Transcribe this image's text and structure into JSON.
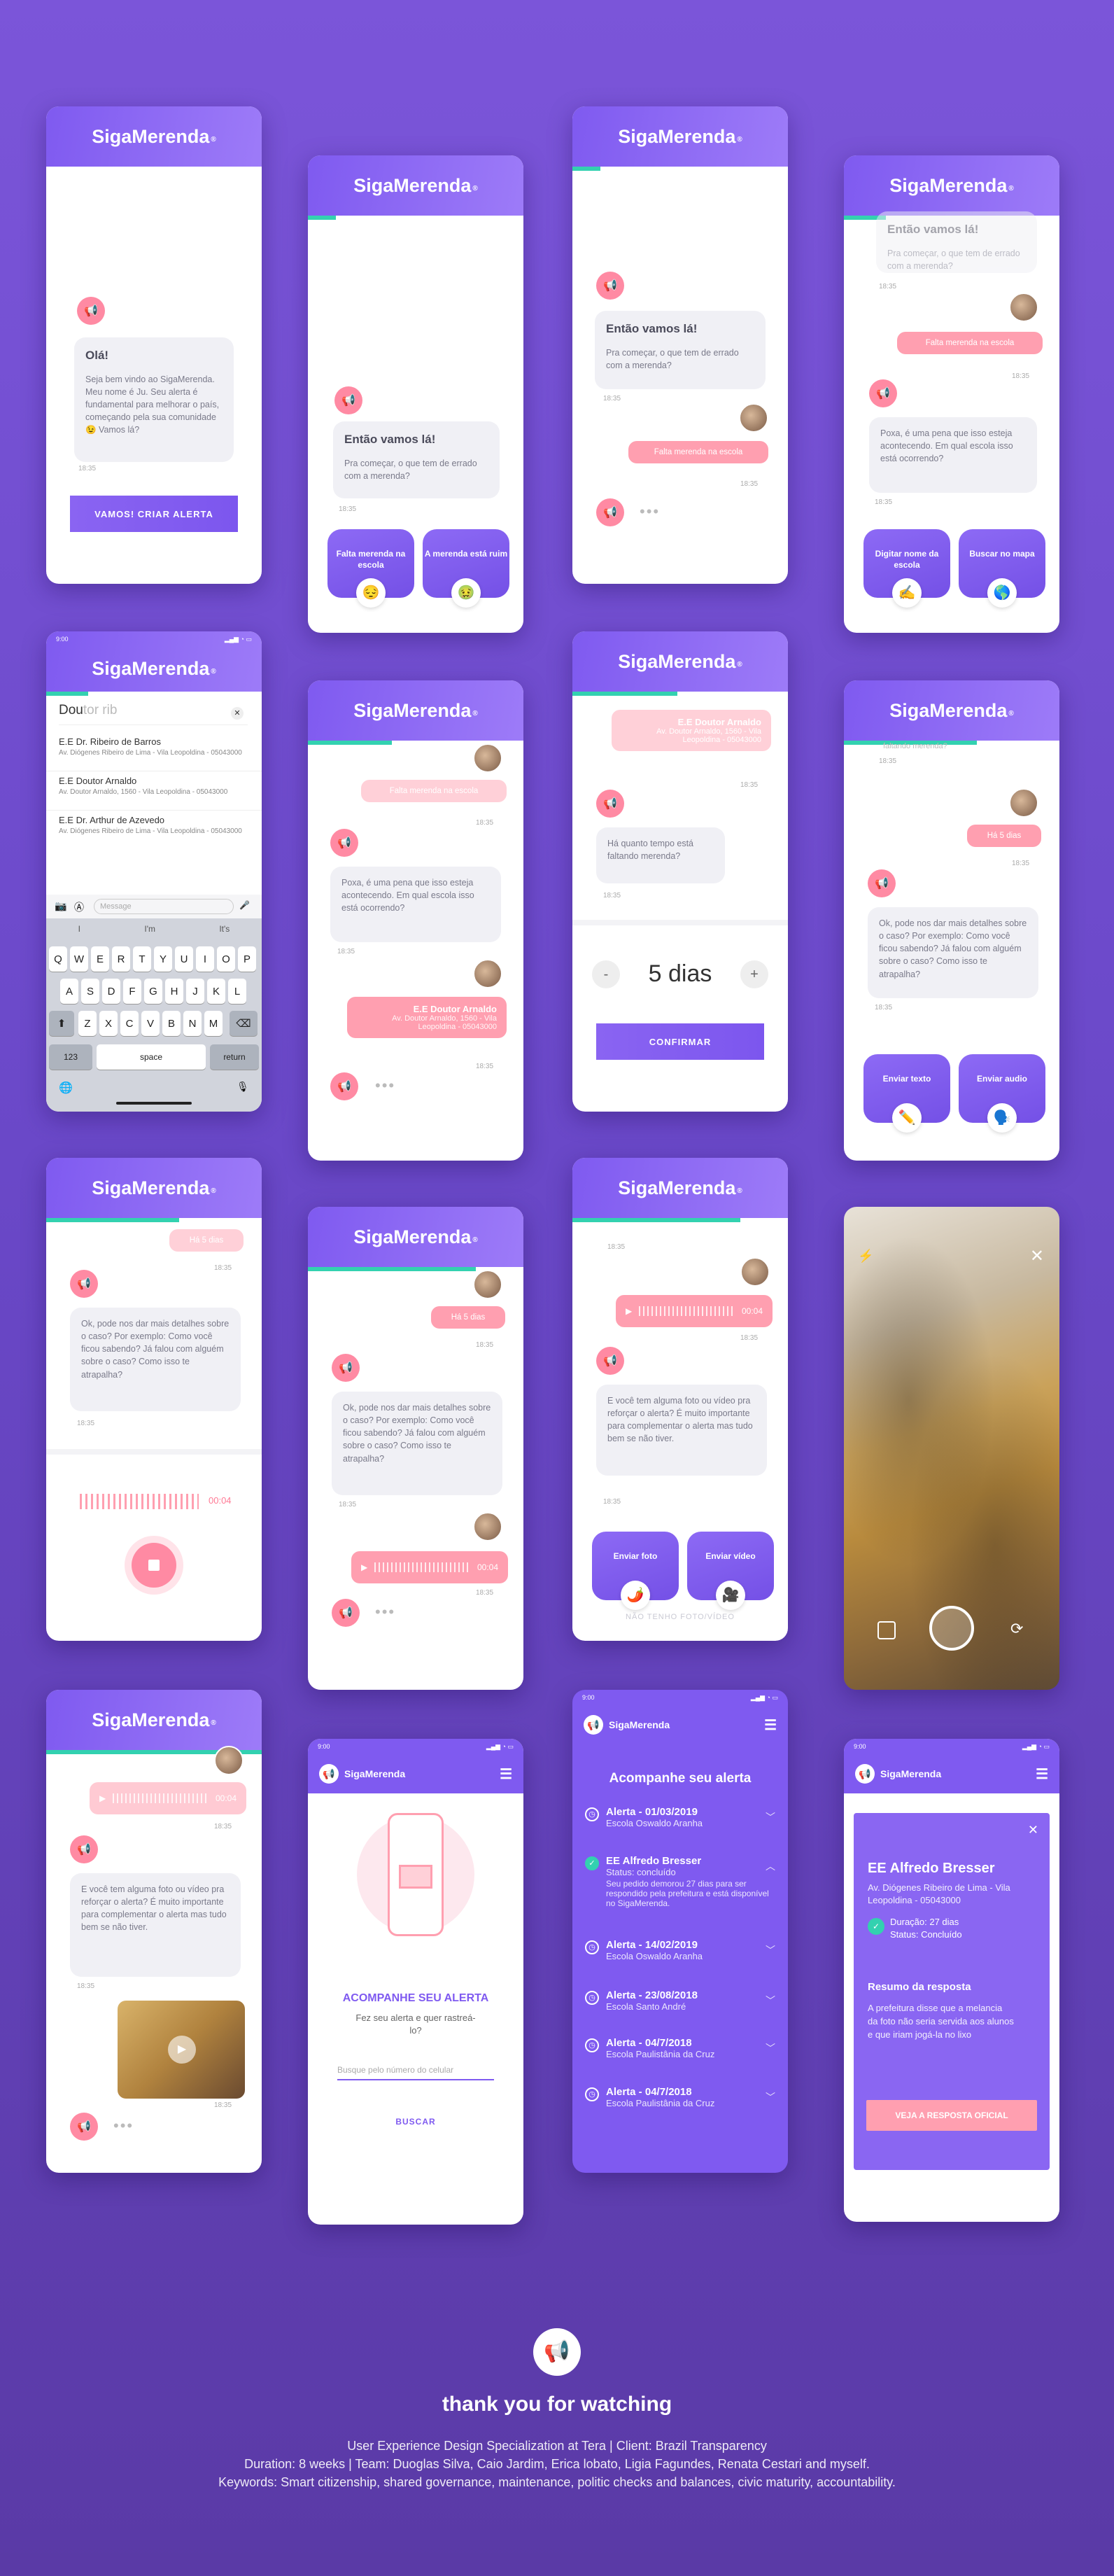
{
  "brand": {
    "name": "SigaMerenda",
    "reg": "®"
  },
  "status": {
    "time": "9:00"
  },
  "s1": {
    "title": "Olá!",
    "text": "Seja bem vindo ao SigaMerenda. Meu nome é Ju. Seu alerta é fundamental para melhorar o país, começando pela sua comunidade 😉 Vamos lá?",
    "time": "18:35",
    "cta": "VAMOS! CRIAR ALERTA"
  },
  "s2": {
    "title": "Então vamos lá!",
    "text": "Pra começar, o que tem de errado com a merenda?",
    "time": "18:35",
    "opt1": "Falta merenda na escola",
    "opt2": "A merenda está ruim",
    "icon1": "😔",
    "icon2": "🤢"
  },
  "s3": {
    "title": "Então vamos lá!",
    "text": "Pra começar, o que tem de errado com a merenda?",
    "time": "18:35",
    "reply": "Falta merenda na escola",
    "time2": "18:35"
  },
  "s4": {
    "title": "Então vamos lá!",
    "text": "Pra começar, o que tem de errado com a merenda?",
    "time": "18:35",
    "reply": "Falta merenda na escola",
    "time2": "18:35",
    "q": "Poxa, é uma pena que isso esteja acontecendo. Em qual escola isso está ocorrendo?",
    "time3": "18:35",
    "opt1": "Digitar nome da escola",
    "opt2": "Buscar no mapa",
    "icon1": "✍️",
    "icon2": "🌎"
  },
  "s5": {
    "search": "Dou",
    "search_rest": "tor rib",
    "results": [
      {
        "name": "E.E Dr. Ribeiro de Barros",
        "addr": "Av. Diógenes Ribeiro de Lima - Vila Leopoldina - 05043000"
      },
      {
        "name": "E.E Doutor Arnaldo",
        "addr": "Av. Doutor Arnaldo, 1560 - Vila Leopoldina - 05043000"
      },
      {
        "name": "E.E Dr. Arthur de Azevedo",
        "addr": "Av. Diógenes Ribeiro de Lima - Vila Leopoldina - 05043000"
      }
    ],
    "placeholder": "Message",
    "sugg": [
      "I",
      "I'm",
      "It's"
    ],
    "row1": [
      "Q",
      "W",
      "E",
      "R",
      "T",
      "Y",
      "U",
      "I",
      "O",
      "P"
    ],
    "row2": [
      "A",
      "S",
      "D",
      "F",
      "G",
      "H",
      "J",
      "K",
      "L"
    ],
    "row3": [
      "Z",
      "X",
      "C",
      "V",
      "B",
      "N",
      "M"
    ],
    "k123": "123",
    "space": "space",
    "ret": "return"
  },
  "s6": {
    "reply": "Falta merenda na escola",
    "time": "18:35",
    "q": "Poxa, é uma pena que isso esteja acontecendo. Em qual escola isso está ocorrendo?",
    "time2": "18:35",
    "school": "E.E Doutor Arnaldo",
    "addr": "Av. Doutor Arnaldo, 1560 - Vila Leopoldina - 05043000",
    "time3": "18:35"
  },
  "s7": {
    "school": "E.E Doutor Arnaldo",
    "addr": "Av. Doutor Arnaldo, 1560 - Vila Leopoldina - 05043000",
    "time": "18:35",
    "q": "Há quanto tempo está faltando merenda?",
    "time2": "18:35",
    "value": "5 dias",
    "minus": "-",
    "plus": "+",
    "cta": "CONFIRMAR"
  },
  "s8": {
    "top": "faltando merenda?",
    "time": "18:35",
    "reply": "Há 5 dias",
    "time2": "18:35",
    "q": "Ok, pode nos dar mais detalhes sobre o caso? Por exemplo: Como você ficou sabendo? Já falou com alguém sobre o caso? Como isso te atrapalha?",
    "time3": "18:35",
    "opt1": "Enviar texto",
    "opt2": "Enviar audio",
    "icon1": "✏️",
    "icon2": "🗣️"
  },
  "s9": {
    "reply": "Há 5 dias",
    "time": "18:35",
    "q": "Ok, pode nos dar mais detalhes sobre o caso? Por exemplo: Como você ficou sabendo? Já falou com alguém sobre o caso? Como isso te atrapalha?",
    "time2": "18:35",
    "rec": "00:04"
  },
  "s10": {
    "reply": "Há 5 dias",
    "time": "18:35",
    "q": "Ok, pode nos dar mais detalhes sobre o caso? Por exemplo: Como você ficou sabendo? Já falou com alguém sobre o caso? Como isso te atrapalha?",
    "time2": "18:35",
    "audio": "00:04",
    "time3": "18:35"
  },
  "s11": {
    "time": "18:35",
    "audio": "00:04",
    "time2": "18:35",
    "q": "E você tem alguma foto ou vídeo pra reforçar o alerta? É muito importante para complementar o alerta mas tudo bem se não tiver.",
    "time3": "18:35",
    "opt1": "Enviar foto",
    "opt2": "Enviar vídeo",
    "icon1": "🌶️",
    "icon2": "🎥",
    "skip": "NÃO TENHO FOTO/VÍDEO"
  },
  "s13": {
    "audio": "00:04",
    "time": "18:35",
    "q": "E você tem alguma foto ou vídeo pra reforçar o alerta? É muito importante para complementar o alerta mas tudo bem se não tiver.",
    "time2": "18:35",
    "time3": "18:35"
  },
  "s14": {
    "title": "ACOMPANHE SEU ALERTA",
    "sub": "Fez seu alerta e quer rastreá-lo?",
    "placeholder": "Busque pelo número do celular",
    "cta": "BUSCAR"
  },
  "s15": {
    "title": "Acompanhe seu alerta",
    "items": [
      {
        "t": "Alerta - 01/03/2019",
        "s": "Escola Oswaldo Aranha"
      },
      {
        "t": "EE Alfredo Bresser",
        "s": "Status: concluído",
        "d": "Seu pedido demorou 27 dias para ser respondido pela prefeitura e está disponível no SigaMerenda."
      },
      {
        "t": "Alerta - 14/02/2019",
        "s": "Escola Oswaldo Aranha"
      },
      {
        "t": "Alerta - 23/08/2018",
        "s": "Escola Santo André"
      },
      {
        "t": "Alerta - 04/7/2018",
        "s": "Escola Paulistânia da Cruz"
      },
      {
        "t": "Alerta - 04/7/2018",
        "s": "Escola Paulistânia da Cruz"
      }
    ]
  },
  "s16": {
    "title": "EE Alfredo Bresser",
    "addr": "Av. Diógenes Ribeiro de Lima - Vila Leopoldina - 05043000",
    "dur": "Duração: 27 dias",
    "status": "Status: Concluído",
    "sum": "Resumo da resposta",
    "sumtext": "A prefeitura disse que a melancia da foto não seria servida aos alunos e que iriam jogá-la no lixo",
    "cta": "VEJA A RESPOSTA OFICIAL"
  },
  "footer": {
    "thanks": "thank you for watching",
    "l1": "User Experience Design Specialization at Tera | Client: Brazil Transparency",
    "l2": "Duration: 8 weeks | Team: Duoglas Silva, Caio Jardim, Erica lobato, Ligia Fagundes, Renata Cestari and myself.",
    "l3": "Keywords: Smart citizenship, shared governance, maintenance, politic checks and balances, civic maturity, accountability."
  },
  "colors": {
    "primary": "#7f5af0",
    "accent": "#33d1b0",
    "pink": "#ff9fb0"
  }
}
